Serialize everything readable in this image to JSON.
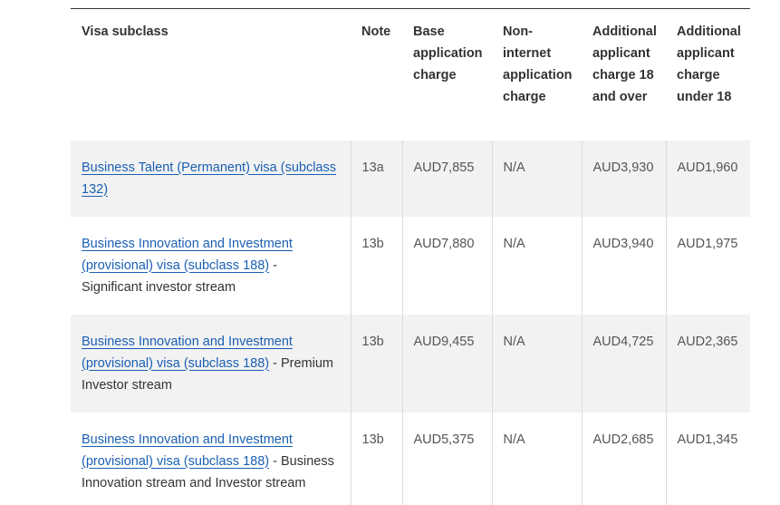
{
  "table": {
    "headers": [
      "Visa subclass",
      "Note",
      "Base application charge",
      "Non-internet application charge",
      "Additional applicant charge 18 and over",
      "Additional applicant charge under 18"
    ],
    "rows": [
      {
        "link": "Business Talent (Permanent) visa (subclass 132)",
        "suffix": "",
        "note": "13a",
        "base": "AUD7,855",
        "non_internet": "N/A",
        "add_18_over": "AUD3,930",
        "add_under_18": "AUD1,960"
      },
      {
        "link": "Business Innovation and Investment (provisional) visa (subclass 188)",
        "suffix": " - Significant investor stream",
        "note": "13b",
        "base": "AUD7,880",
        "non_internet": "N/A",
        "add_18_over": "AUD3,940",
        "add_under_18": "AUD1,975"
      },
      {
        "link": "Business Innovation and Investment (provisional) visa (subclass 188)",
        "suffix": " - Premium Investor stream",
        "note": "13b",
        "base": "AUD9,455",
        "non_internet": "N/A",
        "add_18_over": "AUD4,725",
        "add_under_18": "AUD2,365"
      },
      {
        "link": "Business Innovation and Investment (provisional) visa (subclass 188)",
        "suffix": " - Business Innovation stream and Investor stream",
        "note": "13b",
        "base": "AUD5,375",
        "non_internet": "N/A",
        "add_18_over": "AUD2,685",
        "add_under_18": "AUD1,345"
      }
    ]
  },
  "colors": {
    "link": "#1a5fb4",
    "shade": "#f2f2f2",
    "text": "#333333"
  }
}
